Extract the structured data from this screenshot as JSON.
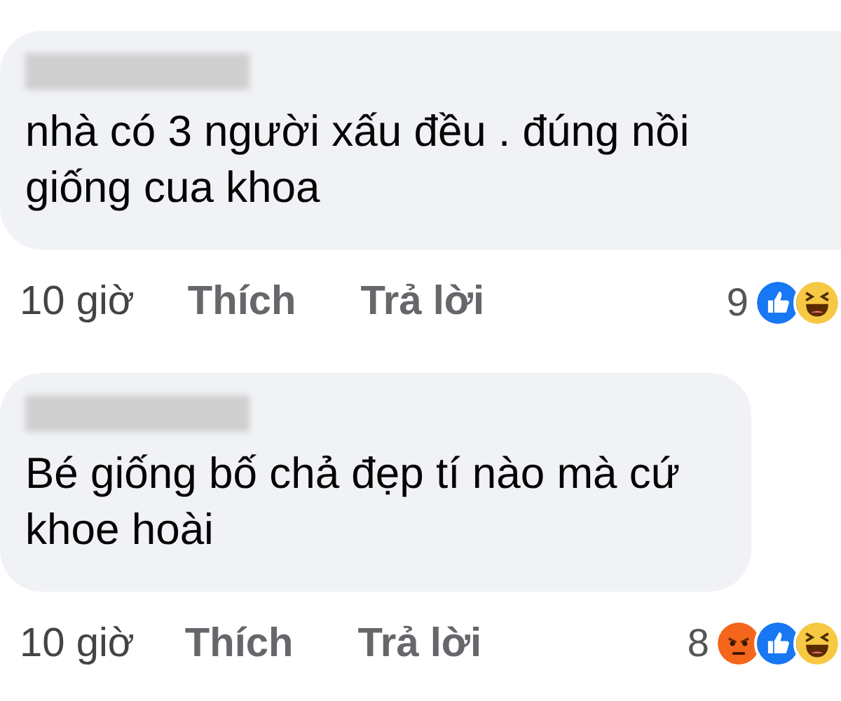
{
  "comments": [
    {
      "text": "nhà có 3 người xấu đều . đúng nồi\ngiống cua khoa",
      "time": "10 giờ",
      "like": "Thích",
      "reply": "Trả lời",
      "reaction_count": "9",
      "reactions": [
        {
          "kind": "like"
        },
        {
          "kind": "haha"
        }
      ],
      "wide": true
    },
    {
      "text": "Bé giống bố chả đẹp tí nào mà cứ\nkhoe hoài",
      "time": "10 giờ",
      "like": "Thích",
      "reply": "Trả lời",
      "reaction_count": "8",
      "reactions": [
        {
          "kind": "angry"
        },
        {
          "kind": "like"
        },
        {
          "kind": "haha"
        }
      ],
      "wide": false
    }
  ]
}
